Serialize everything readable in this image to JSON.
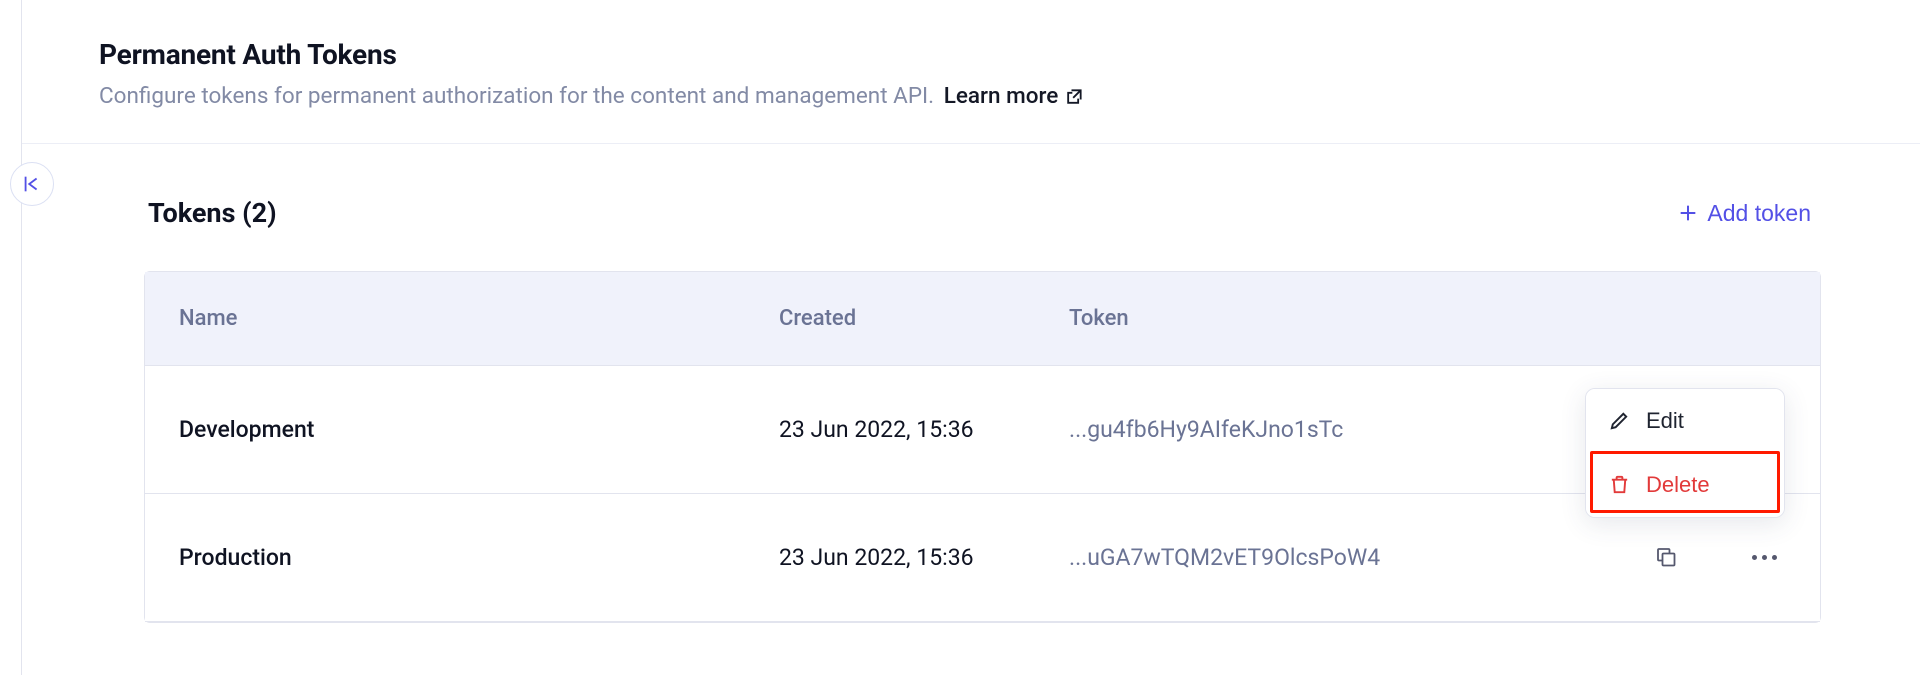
{
  "header": {
    "title": "Permanent Auth Tokens",
    "subtitle": "Configure tokens for permanent authorization for the content and management API.",
    "learn_more": "Learn more"
  },
  "tokens": {
    "title_prefix": "Tokens",
    "count": "2",
    "add_button": "Add token",
    "columns": {
      "name": "Name",
      "created": "Created",
      "token": "Token"
    },
    "rows": [
      {
        "name": "Development",
        "created": "23 Jun 2022, 15:36",
        "token": "...gu4fb6Hy9AIfeKJno1sTc"
      },
      {
        "name": "Production",
        "created": "23 Jun 2022, 15:36",
        "token": "...uGA7wTQM2vET9OlcsPoW4"
      }
    ]
  },
  "menu": {
    "edit": "Edit",
    "delete": "Delete"
  }
}
